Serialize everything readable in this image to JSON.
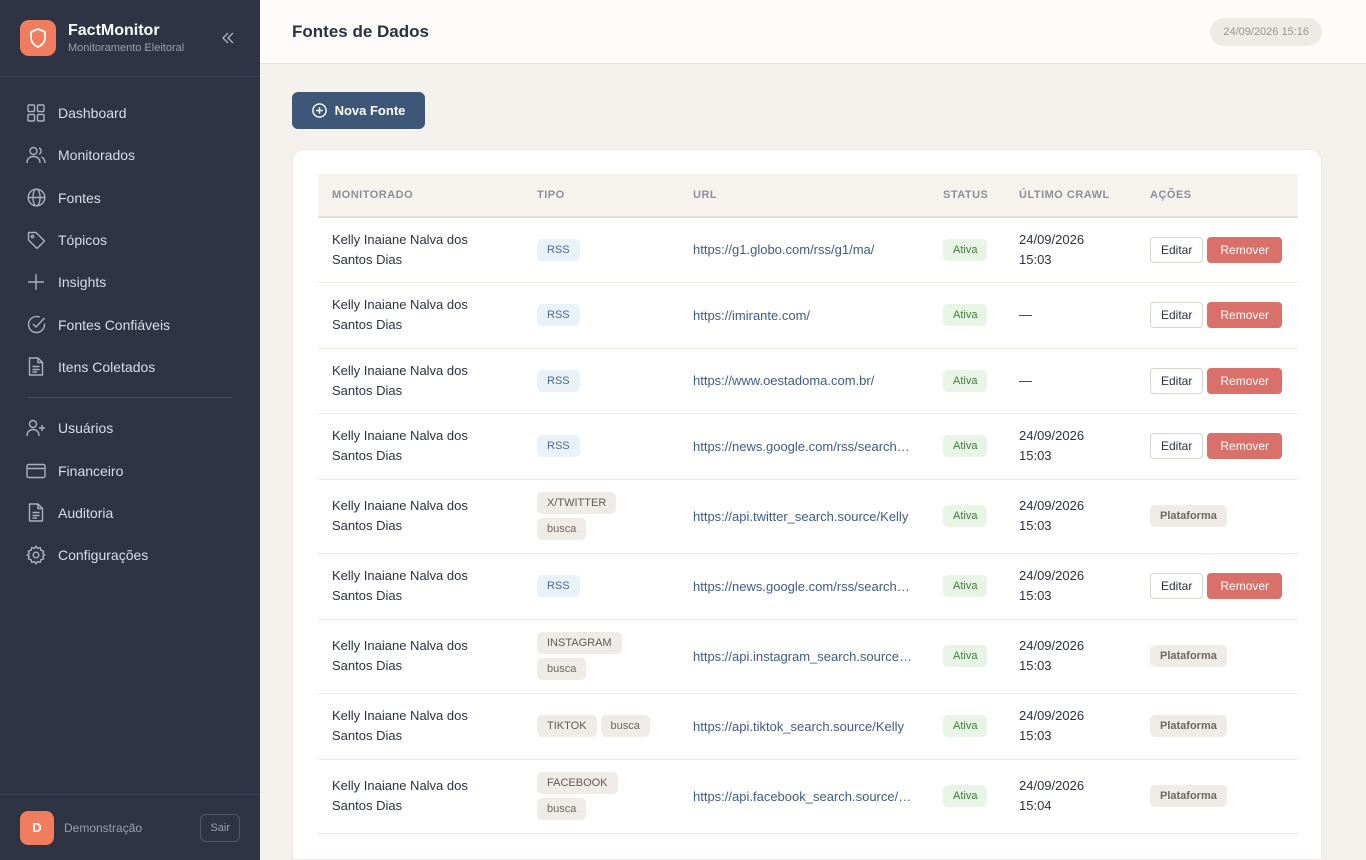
{
  "brand": {
    "name": "FactMonitor",
    "subtitle": "Monitoramento Eleitoral"
  },
  "nav": {
    "items": [
      {
        "label": "Dashboard",
        "icon": "grid-icon"
      },
      {
        "label": "Monitorados",
        "icon": "users-icon"
      },
      {
        "label": "Fontes",
        "icon": "globe-icon"
      },
      {
        "label": "Tópicos",
        "icon": "tag-icon"
      },
      {
        "label": "Insights",
        "icon": "plus-icon"
      },
      {
        "label": "Fontes Confiáveis",
        "icon": "check-circle-icon"
      },
      {
        "label": "Itens Coletados",
        "icon": "document-icon"
      }
    ],
    "admin_items": [
      {
        "label": "Usuários",
        "icon": "user-plus-icon"
      },
      {
        "label": "Financeiro",
        "icon": "credit-card-icon"
      },
      {
        "label": "Auditoria",
        "icon": "file-icon"
      },
      {
        "label": "Configurações",
        "icon": "gear-icon"
      }
    ]
  },
  "user": {
    "initial": "D",
    "name": "Demonstração",
    "logout_label": "Sair"
  },
  "header": {
    "title": "Fontes de Dados",
    "datetime": "24/09/2026 15:16"
  },
  "actions": {
    "new_source_label": "Nova Fonte"
  },
  "table": {
    "columns": [
      "MONITORADO",
      "TIPO",
      "URL",
      "STATUS",
      "ÚLTIMO CRAWL",
      "AÇÕES"
    ],
    "rows": [
      {
        "monitorado": "Kelly Inaiane Nalva dos Santos Dias",
        "tipo": [
          "RSS"
        ],
        "url": "https://g1.globo.com/rss/g1/ma/",
        "status": "Ativa",
        "crawl_date": "24/09/2026",
        "crawl_time": "15:03",
        "acoes": "edit"
      },
      {
        "monitorado": "Kelly Inaiane Nalva dos Santos Dias",
        "tipo": [
          "RSS"
        ],
        "url": "https://imirante.com/",
        "status": "Ativa",
        "crawl_date": "—",
        "crawl_time": "",
        "acoes": "edit"
      },
      {
        "monitorado": "Kelly Inaiane Nalva dos Santos Dias",
        "tipo": [
          "RSS"
        ],
        "url": "https://www.oestadoma.com.br/",
        "status": "Ativa",
        "crawl_date": "—",
        "crawl_time": "",
        "acoes": "edit"
      },
      {
        "monitorado": "Kelly Inaiane Nalva dos Santos Dias",
        "tipo": [
          "RSS"
        ],
        "url": "https://news.google.com/rss/search?q=Kelly",
        "status": "Ativa",
        "crawl_date": "24/09/2026",
        "crawl_time": "15:03",
        "acoes": "edit"
      },
      {
        "monitorado": "Kelly Inaiane Nalva dos Santos Dias",
        "tipo": [
          "X/TWITTER",
          "busca"
        ],
        "url": "https://api.twitter_search.source/Kelly",
        "status": "Ativa",
        "crawl_date": "24/09/2026",
        "crawl_time": "15:03",
        "acoes": "platform"
      },
      {
        "monitorado": "Kelly Inaiane Nalva dos Santos Dias",
        "tipo": [
          "RSS"
        ],
        "url": "https://news.google.com/rss/search?q=Kelly",
        "status": "Ativa",
        "crawl_date": "24/09/2026",
        "crawl_time": "15:03",
        "acoes": "edit"
      },
      {
        "monitorado": "Kelly Inaiane Nalva dos Santos Dias",
        "tipo": [
          "INSTAGRAM",
          "busca"
        ],
        "url": "https://api.instagram_search.source/Kelly",
        "status": "Ativa",
        "crawl_date": "24/09/2026",
        "crawl_time": "15:03",
        "acoes": "platform"
      },
      {
        "monitorado": "Kelly Inaiane Nalva dos Santos Dias",
        "tipo": [
          "TIKTOK",
          "busca"
        ],
        "url": "https://api.tiktok_search.source/Kelly",
        "status": "Ativa",
        "crawl_date": "24/09/2026",
        "crawl_time": "15:03",
        "acoes": "platform"
      },
      {
        "monitorado": "Kelly Inaiane Nalva dos Santos Dias",
        "tipo": [
          "FACEBOOK",
          "busca"
        ],
        "url": "https://api.facebook_search.source/Kelly",
        "status": "Ativa",
        "crawl_date": "24/09/2026",
        "crawl_time": "15:04",
        "acoes": "platform"
      }
    ],
    "edit_label": "Editar",
    "remove_label": "Remover",
    "platform_label": "Plataforma"
  },
  "colors": {
    "sidebar": "#2f3445",
    "accent": "#ef7d5e",
    "primary_button": "#3e5678",
    "remove": "#d9706a",
    "status_active": "#3e7d3a"
  }
}
